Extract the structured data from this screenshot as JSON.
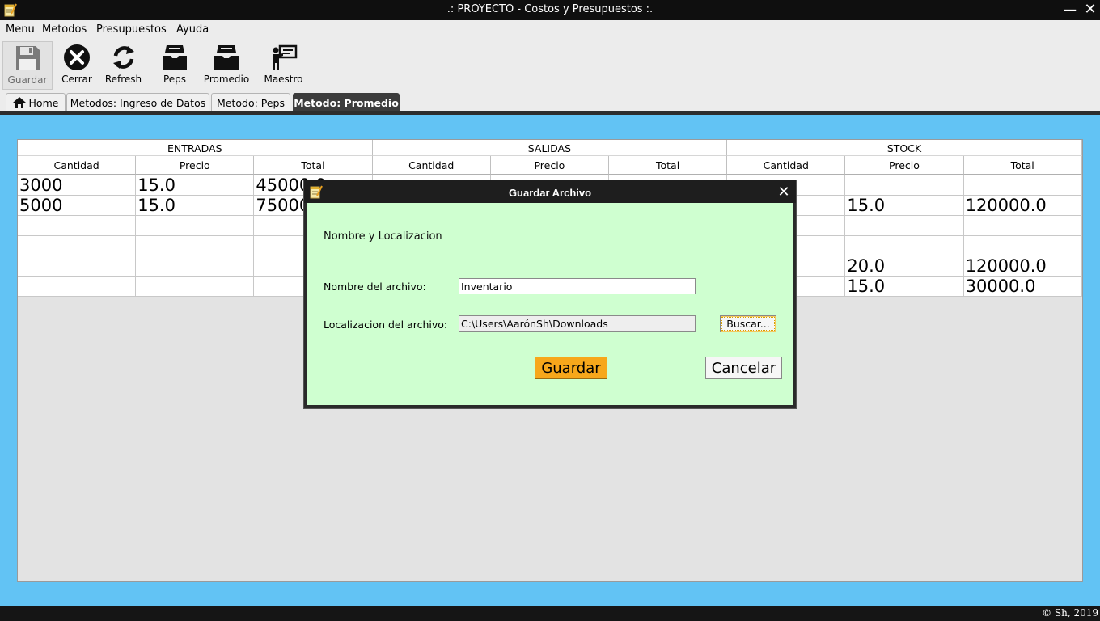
{
  "window": {
    "title": ".: PROYECTO - Costos y Presupuestos :.",
    "minimize_glyph": "—",
    "close_glyph": "✕",
    "icon": "notepad-icon"
  },
  "menubar": {
    "items": [
      "Menu",
      "Metodos",
      "Presupuestos",
      "Ayuda"
    ]
  },
  "toolbar": {
    "buttons": [
      {
        "label": "Guardar",
        "icon": "floppy-disk-icon",
        "state": "pressed"
      },
      {
        "label": "Cerrar",
        "icon": "close-circle-icon"
      },
      {
        "label": "Refresh",
        "icon": "refresh-icon"
      },
      {
        "label": "Peps",
        "icon": "inbox-tray-icon"
      },
      {
        "label": "Promedio",
        "icon": "inbox-tray-icon"
      },
      {
        "label": "Maestro",
        "icon": "presenter-board-icon"
      }
    ]
  },
  "tabs": {
    "items": [
      {
        "label": "Home",
        "icon": "home-icon"
      },
      {
        "label": "Metodos: Ingreso de Datos"
      },
      {
        "label": "Metodo: Peps"
      },
      {
        "label": "Metodo: Promedio",
        "active": true
      }
    ]
  },
  "table": {
    "groups": [
      "ENTRADAS",
      "SALIDAS",
      "STOCK"
    ],
    "columns": [
      "Cantidad",
      "Precio",
      "Total",
      "Cantidad",
      "Precio",
      "Total",
      "Cantidad",
      "Precio",
      "Total"
    ],
    "rows": [
      [
        "3000",
        "15.0",
        "45000.0",
        "",
        "",
        "",
        "",
        "",
        ""
      ],
      [
        "5000",
        "15.0",
        "75000.0",
        "",
        "",
        "",
        "",
        "15.0",
        "120000.0"
      ],
      [
        "",
        "",
        "",
        "",
        "",
        "",
        "",
        "",
        ""
      ],
      [
        "",
        "",
        "",
        "",
        "",
        "",
        "",
        "",
        ""
      ],
      [
        "",
        "",
        "",
        "",
        "",
        "",
        "",
        "20.0",
        "120000.0"
      ],
      [
        "",
        "",
        "",
        "",
        "",
        "",
        "",
        "15.0",
        "30000.0"
      ]
    ]
  },
  "statusbar": {
    "copyright": "© Sh, 2019"
  },
  "dialog": {
    "title": "Guardar Archivo",
    "close_glyph": "✕",
    "section_title": "Nombre y Localizacion",
    "name_label": "Nombre del archivo:",
    "name_value": "Inventario",
    "location_label": "Localizacion del archivo:",
    "location_value": "C:\\Users\\AarónSh\\Downloads",
    "browse_label": "Buscar...",
    "save_label": "Guardar",
    "cancel_label": "Cancelar"
  },
  "colors": {
    "content_bg": "#62c3f4",
    "dialog_bg": "#cfffd0",
    "primary_button": "#f7a71b",
    "titlebar": "#0f0f0f"
  }
}
